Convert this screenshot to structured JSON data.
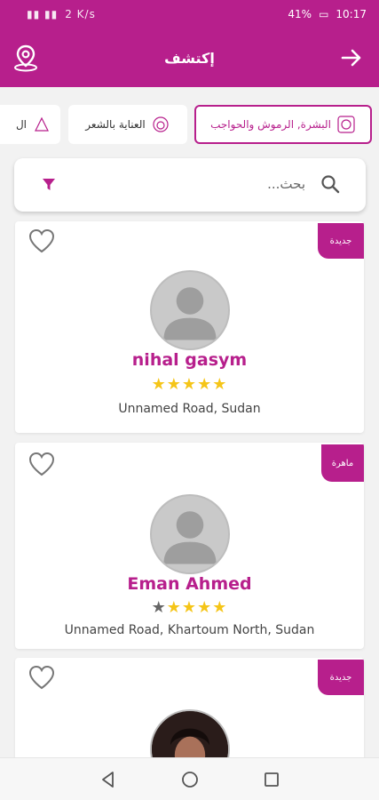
{
  "status_bar": {
    "signal_text": "\u0005\u0005 \u0005 \u0005 ",
    "network": "2 K/s",
    "battery": "41%",
    "time": "10:17"
  },
  "app_bar": {
    "title": "إكتشف"
  },
  "categories": [
    {
      "label": "البشرة, الرموش والحواجب",
      "active": true
    },
    {
      "label": "العناية بالشعر",
      "active": false
    },
    {
      "label": "ال",
      "active": false
    }
  ],
  "search": {
    "placeholder": "بحث..."
  },
  "listings": [
    {
      "badge": "جديدة",
      "name": "nihal gasym",
      "stars": "★★★★★",
      "address": "Unnamed Road, Sudan"
    },
    {
      "badge": "ماهرة",
      "name": "Eman Ahmed",
      "stars_half": "★",
      "stars": "★★★★",
      "address": "Unnamed Road, Khartoum North, Sudan"
    },
    {
      "badge": "جديدة"
    }
  ],
  "colors": {
    "accent": "#b71f8c",
    "star": "#f5c518"
  }
}
